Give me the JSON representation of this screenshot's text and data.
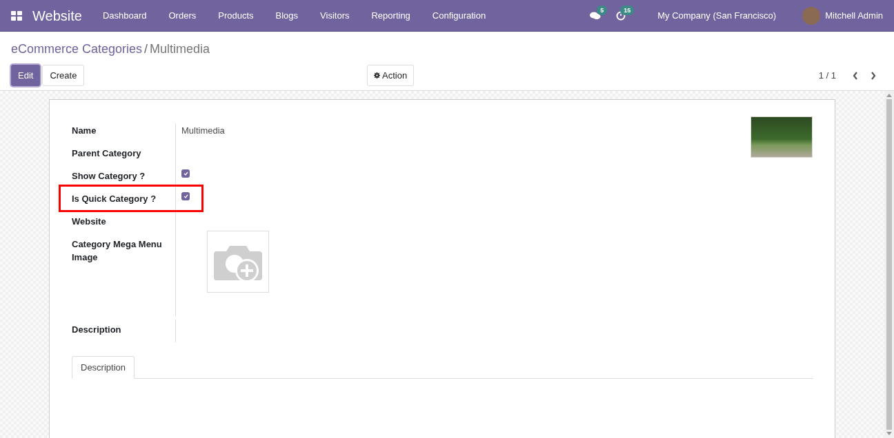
{
  "app": {
    "title": "Website"
  },
  "menu": [
    "Dashboard",
    "Orders",
    "Products",
    "Blogs",
    "Visitors",
    "Reporting",
    "Configuration"
  ],
  "systray": {
    "messages_count": "5",
    "activities_count": "15",
    "company": "My Company (San Francisco)",
    "user": "Mitchell Admin"
  },
  "breadcrumb_separator": "/",
  "breadcrumb": [
    {
      "label": "eCommerce Categories",
      "kind": "link"
    },
    {
      "label": "Multimedia",
      "kind": "current"
    }
  ],
  "buttons": [
    {
      "label": "Edit",
      "primary": true
    },
    {
      "label": "Create",
      "primary": false
    }
  ],
  "action_button": "Action",
  "pager": "1 / 1",
  "fields": [
    {
      "label": "Name",
      "kind": "text",
      "value": "Multimedia",
      "highlighted": false
    },
    {
      "label": "Parent Category",
      "kind": "empty",
      "highlighted": false
    },
    {
      "label": "Show Category ?",
      "kind": "checkbox",
      "checked": true,
      "highlighted": false
    },
    {
      "label": "Is Quick Category ?",
      "kind": "checkbox",
      "checked": true,
      "highlighted": true
    },
    {
      "label": "Website",
      "kind": "empty",
      "highlighted": false
    },
    {
      "label": "Category Mega Menu Image",
      "kind": "image",
      "highlighted": false
    }
  ],
  "description_label": "Description",
  "tabs": [
    {
      "label": "Description",
      "selected": true
    }
  ]
}
